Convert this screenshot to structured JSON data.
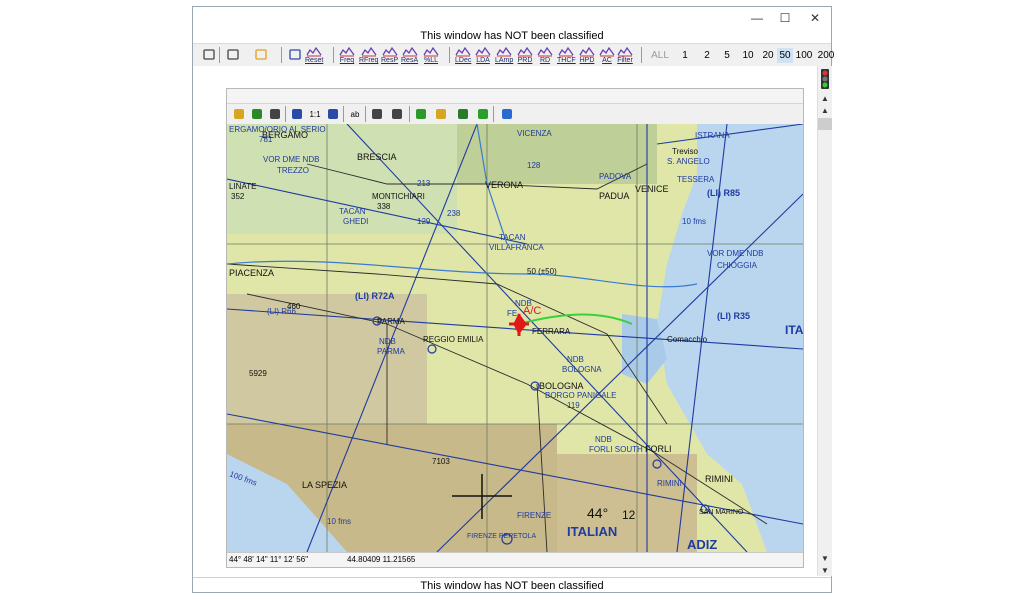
{
  "window": {
    "classification_top": "This window has NOT been classified",
    "classification_bottom": "This window has NOT been classified",
    "controls": {
      "minimize": "—",
      "maximize": "☐",
      "close": "✕"
    }
  },
  "toolbar": {
    "buttons": [
      {
        "id": "lock",
        "label": "",
        "icon": "lock-icon"
      },
      {
        "id": "print",
        "label": "",
        "icon": "printer-icon"
      },
      {
        "id": "color",
        "label": "",
        "icon": "pen-color-icon"
      },
      {
        "id": "select",
        "label": "",
        "icon": "select-icon"
      },
      {
        "id": "reset",
        "label": "Reset"
      },
      {
        "id": "freq",
        "label": "Freq"
      },
      {
        "id": "rfreq",
        "label": "RFreq"
      },
      {
        "id": "resp",
        "label": "ResP"
      },
      {
        "id": "resa",
        "label": "ResA"
      },
      {
        "id": "pctll",
        "label": "%LL"
      },
      {
        "id": "ldec",
        "label": "LDec"
      },
      {
        "id": "lda",
        "label": "LDA"
      },
      {
        "id": "lamp",
        "label": "LAmp"
      },
      {
        "id": "prd",
        "label": "PRD"
      },
      {
        "id": "rd",
        "label": "RD"
      },
      {
        "id": "thcf",
        "label": "THCF"
      },
      {
        "id": "hpd",
        "label": "HPD"
      },
      {
        "id": "ac",
        "label": "AC"
      },
      {
        "id": "filter",
        "label": "Filter"
      }
    ],
    "ranges": [
      "ALL",
      "1",
      "2",
      "5",
      "10",
      "20",
      "50",
      "100",
      "200"
    ],
    "range_selected": "50"
  },
  "map_toolbar": {
    "buttons": [
      "open-folder-icon",
      "map-layer-icon",
      "grid-icon",
      "zoom-in-icon",
      "one-to-one-icon",
      "zoom-out-icon",
      "text-label-icon",
      "measure-icon",
      "pan-hand-icon",
      "clear-icon",
      "open-file-icon",
      "save-image-icon",
      "person-icon",
      "globe-icon"
    ],
    "one_to_one_label": "1:1",
    "text_label": "ab"
  },
  "map": {
    "labels": {
      "bergamo": "BERGAMO",
      "orio": "ERGAMO/ORIO AL SERIO",
      "v781": "781",
      "vor_trezzo": "VOR DME NDB",
      "trezzo": "TREZZO",
      "brescia": "BRESCIA",
      "verona": "VERONA",
      "vicenza": "VICENZA",
      "v128": "128",
      "istrana": "ISTRANA",
      "treviso": "Treviso",
      "sangelo": "S. ANGELO",
      "padova": "PADOVA",
      "padua": "PADUA",
      "venice": "VENICE",
      "tessera": "TESSERA",
      "li_r85": "(LI) R85",
      "montichiari": "MONTICHIARI",
      "v338": "338",
      "linate": "LINATE",
      "v352": "352",
      "tacan_ghedi": "TACAN",
      "ghedi": "GHEDI",
      "tacan_villafranca": "TACAN",
      "villafranca": "VILLAFRANCA",
      "v50": "50 (±50)",
      "chioggia_vor": "VOR DME NDB",
      "chioggia": "CHIOGGIA",
      "piacenza": "PIACENZA",
      "li_r72a": "(LI) R72A",
      "parma": "PARMA",
      "reggio": "REGGIO EMILIA",
      "ndb_parma": "NDB",
      "parma2": "PARMA",
      "ndb_fe": "NDB",
      "fe": "FE",
      "ac": "A/C",
      "ferrara": "FERRARA",
      "li_r35": "(LI) R35",
      "comacchio": "Comacchio",
      "ital": "ITAL",
      "li_r66": "(LI) R66",
      "v460": "460",
      "v5929": "5929",
      "ndb_bologna": "NDB",
      "bologna_ndb": "BOLOGNA",
      "bologna": "BOLOGNA",
      "borgo": "BORGO PANIGALE",
      "v119": "119",
      "ndb_forli": "NDB",
      "forli_south": "FORLI SOUTH",
      "forli": "FORLI",
      "rimini": "RIMINI",
      "rimini2": "RIMINI",
      "v100fms": "100 fms",
      "laspezia": "LA SPEZIA",
      "v7103": "7103",
      "firenze": "FIRENZE",
      "peretola": "FIRENZE PERETOLA",
      "italian": "ITALIAN",
      "adiz": "ADIZ",
      "deg44": "44°",
      "v12": "12",
      "sanmarino": "SAN MARINO",
      "v10fms": "10 fms",
      "v10fms2": "10 fms",
      "v213": "213",
      "v238": "238",
      "v129": "129"
    }
  },
  "statusbar": {
    "dms": "44° 48' 14\"   11° 12' 56\"",
    "decimal": "44.80409   11.21565"
  },
  "colors": {
    "land": "#dfe6a8",
    "water": "#b9d6ee",
    "chart_blue": "#1f3aa0",
    "route_green": "#37d23b",
    "aircraft_red": "#e01818",
    "selected_range": "#cfe3f5"
  }
}
